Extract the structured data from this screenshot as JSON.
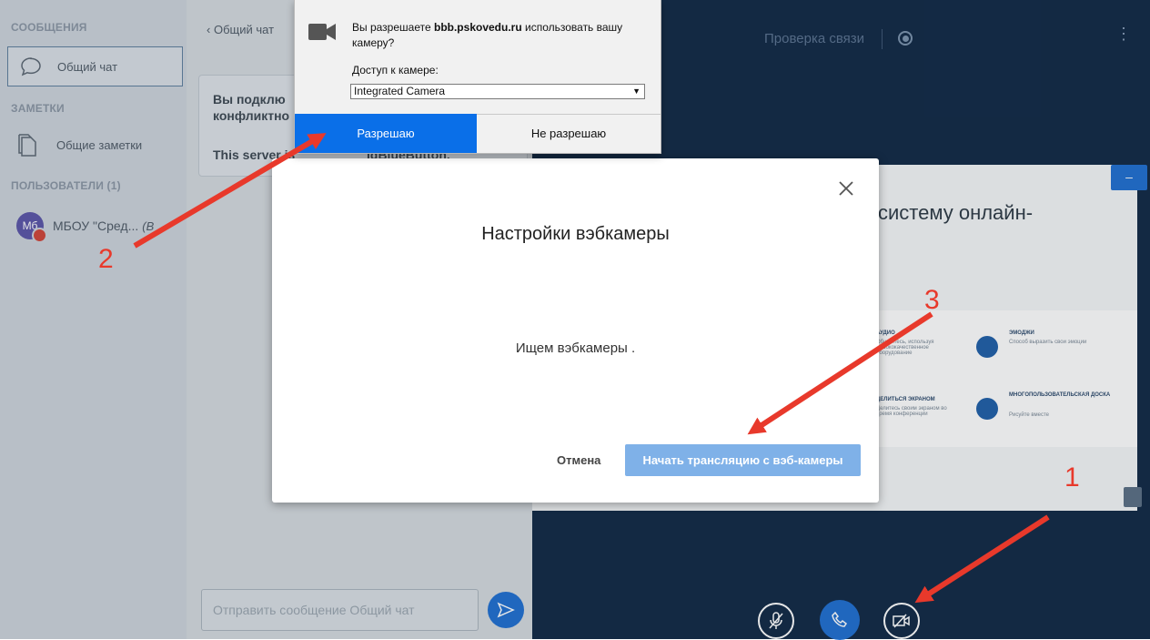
{
  "sidebar": {
    "messages_title": "СООБЩЕНИЯ",
    "public_chat": "Общий чат",
    "notes_title": "ЗАМЕТКИ",
    "shared_notes": "Общие заметки",
    "users_title": "ПОЛЬЗОВАТЕЛИ (1)",
    "user_avatar": "Мб",
    "user_name": "МБОУ \"Сред...",
    "user_role": "(В"
  },
  "chat": {
    "back_label": "Общий чат",
    "welcome_line1": "Вы подклю",
    "welcome_line2": "конфликтно",
    "server_line": "This server is",
    "server_tail": "igBlueButton.",
    "input_placeholder": "Отправить сообщение Общий чат"
  },
  "topbar": {
    "connection_check": "Проверка связи"
  },
  "presentation": {
    "heading": "систему онлайн-",
    "features": [
      {
        "title": "АУДИО",
        "desc": "Общайтесь, используя высококачественное оборудование"
      },
      {
        "title": "ЭМОДЖИ",
        "desc": "Способ выразить свои эмоции"
      },
      {
        "title": "ДЕЛИТЬСЯ ЭКРАНОМ",
        "desc": "Делитесь своим экраном во время конференции"
      },
      {
        "title": "МНОГОПОЛЬЗОВАТЕЛЬСКАЯ ДОСКА",
        "desc": "Рисуйте вместе"
      }
    ]
  },
  "permission": {
    "question_pre": "Вы разрешаете ",
    "site": "bbb.pskovedu.ru",
    "question_post": " использовать вашу камеру?",
    "access_label": "Доступ к камере:",
    "camera_selected": "Integrated Camera",
    "allow_label": "Разрешаю",
    "deny_label": "Не разрешаю"
  },
  "modal": {
    "title": "Настройки вэбкамеры",
    "status": "Ищем вэбкамеры .",
    "cancel_label": "Отмена",
    "start_label": "Начать трансляцию с вэб-камеры"
  },
  "annotations": {
    "one": "1",
    "two": "2",
    "three": "3"
  },
  "colors": {
    "annotation_red": "#e8392b",
    "allow_blue": "#0a6fe8",
    "start_button": "#7fb1e8",
    "video_bg": "#102845"
  },
  "icons": {
    "camera_prompt": "camera-icon",
    "mic_muted": "mic-muted-icon",
    "phone": "phone-icon",
    "video_off": "video-off-icon",
    "send": "send-icon",
    "close": "close-icon"
  }
}
